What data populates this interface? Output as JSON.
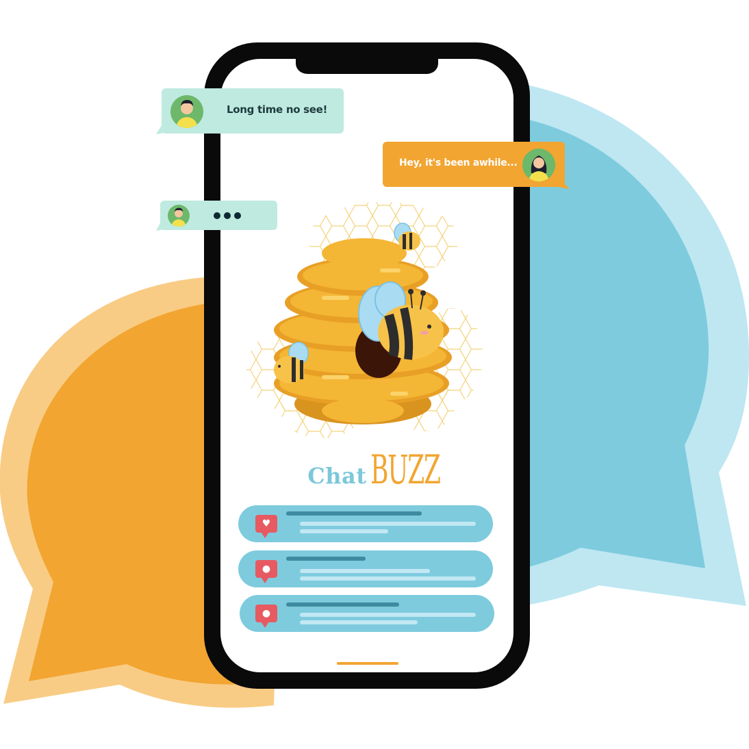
{
  "colors": {
    "orange": "#f2a531",
    "orange_light": "#f8cc85",
    "blue": "#7ecbde",
    "blue_light": "#bee7f1",
    "mint": "#bfeadf",
    "phone_frame": "#0a0a0a",
    "notification_red": "#e75a61"
  },
  "chat_bubbles": [
    {
      "side": "left",
      "text": "Long time no see!",
      "avatar": "man-avatar-icon"
    },
    {
      "side": "right",
      "text": "Hey, it's been awhile...",
      "avatar": "woman-avatar-icon"
    },
    {
      "side": "left",
      "text": "",
      "typing": true,
      "avatar": "man-avatar-icon"
    }
  ],
  "logo": {
    "part1": "Chat",
    "part2": "BUZZ"
  },
  "illustration": "beehive-with-bees",
  "notifications": [
    {
      "icon": "heart-icon"
    },
    {
      "icon": "comment-icon"
    },
    {
      "icon": "user-icon"
    }
  ]
}
